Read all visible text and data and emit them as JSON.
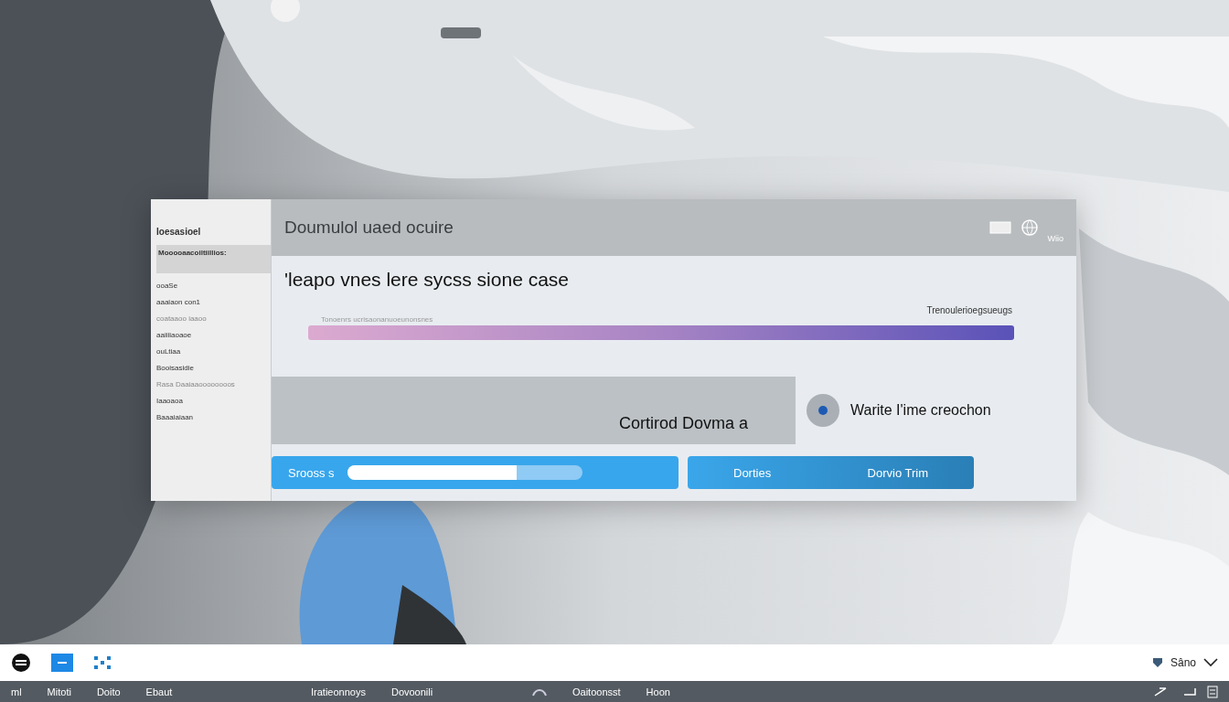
{
  "window": {
    "title": "Doumulol uaed ocuire",
    "corner_label": "Wiio"
  },
  "sidebar": {
    "items": [
      {
        "label": "Ioesasioel",
        "kind": "heading"
      },
      {
        "label": "Mooooaacoiltiillios:",
        "kind": "banner"
      },
      {
        "label": "ooaSe",
        "kind": "text"
      },
      {
        "label": "aaaiaon con1",
        "kind": "text"
      },
      {
        "label": "coataaoo iaaoo",
        "kind": "note"
      },
      {
        "label": "aaiiiiaoaoe",
        "kind": "text"
      },
      {
        "label": "ouLtiaa",
        "kind": "text"
      },
      {
        "label": "Booisasidie",
        "kind": "text"
      },
      {
        "label": "Rasa Daaiaaoooooooos",
        "kind": "note"
      },
      {
        "label": "Iaaoaoa",
        "kind": "text"
      },
      {
        "label": "Baaaiaiaan",
        "kind": "text"
      }
    ]
  },
  "heading": "'leapo vnes lere sycss sione case",
  "progress": {
    "caption": "Tonoenrs ucrisaonanuoeunonsnes",
    "label": "Trenoulerioegsueugs",
    "level": 1.0
  },
  "panel_text": "Cortirod Dovma a",
  "option": {
    "label": "Warite I'ime creochon",
    "selected": true
  },
  "buttons": [
    {
      "kind": "progress",
      "label": "Srooss s",
      "level": 0.72
    },
    {
      "kind": "split",
      "label": "Dorties",
      "secondary": "Dorvio Trim"
    }
  ],
  "taskbar": {
    "tray_label": "Sâno"
  },
  "bottom_bar": {
    "left": [
      "ml",
      "Mitoti",
      "Doito",
      "Ebaut"
    ],
    "center": [
      "Iratieonnoys",
      "Dovoonili"
    ],
    "right": [
      "Oaitoonsst",
      "Hoon"
    ]
  }
}
